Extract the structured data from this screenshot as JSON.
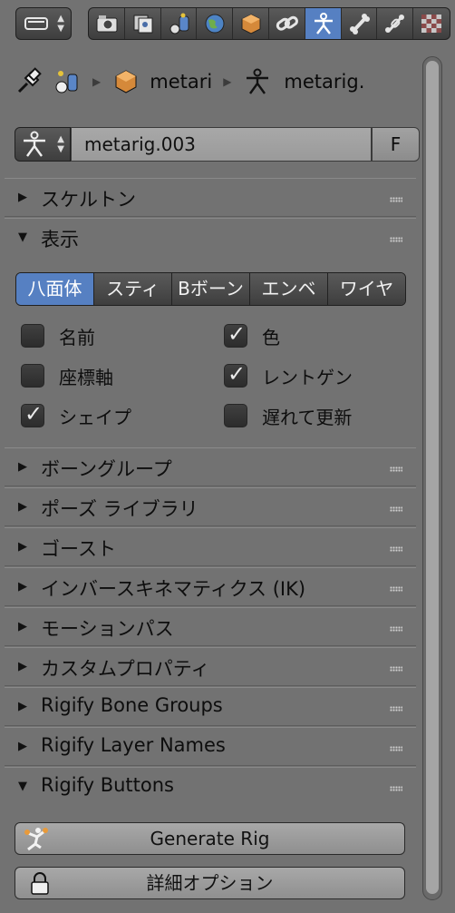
{
  "header": {
    "editor_type_icon": "properties-editor-icon",
    "tabs": [
      {
        "name": "render",
        "icon": "camera-icon",
        "active": false
      },
      {
        "name": "layers",
        "icon": "layers-icon",
        "active": false
      },
      {
        "name": "scene",
        "icon": "scene-icon",
        "active": false
      },
      {
        "name": "world",
        "icon": "world-icon",
        "active": false
      },
      {
        "name": "object",
        "icon": "cube-icon",
        "active": false
      },
      {
        "name": "constraints",
        "icon": "link-icon",
        "active": false
      },
      {
        "name": "armature",
        "icon": "armature-icon",
        "active": true
      },
      {
        "name": "bone",
        "icon": "bone-icon",
        "active": false
      },
      {
        "name": "bone-constraints",
        "icon": "bone-constraint-icon",
        "active": false
      },
      {
        "name": "texture",
        "icon": "checker-icon",
        "active": false
      }
    ]
  },
  "breadcrumbs": {
    "object_name": "metari",
    "armature_name": "metarig."
  },
  "armature": {
    "datablock_name": "metarig.003",
    "fake_user_label": "F"
  },
  "panels": {
    "skeleton": "スケルトン",
    "display": "表示",
    "bone_groups": "ボーングループ",
    "pose_library": "ポーズ ライブラリ",
    "ghost": "ゴースト",
    "ik": "インバースキネマティクス (IK)",
    "motion_paths": "モーションパス",
    "custom_props": "カスタムプロパティ",
    "rigify_bone_groups": "Rigify Bone Groups",
    "rigify_layer_names": "Rigify Layer Names",
    "rigify_buttons": "Rigify Buttons"
  },
  "display": {
    "tabs": [
      "八面体",
      "スティ",
      "Bボーン",
      "エンベ",
      "ワイヤ"
    ],
    "active_tab": 0,
    "options": {
      "names": {
        "label": "名前",
        "checked": false
      },
      "axes": {
        "label": "座標軸",
        "checked": false
      },
      "shapes": {
        "label": "シェイプ",
        "checked": true
      },
      "colors": {
        "label": "色",
        "checked": true
      },
      "xray": {
        "label": "レントゲン",
        "checked": true
      },
      "delay": {
        "label": "遅れて更新",
        "checked": false
      }
    }
  },
  "rigify": {
    "generate_label": "Generate Rig",
    "advanced_label": "詳細オプション"
  },
  "colors": {
    "background": "#727272",
    "active_blue": "#5680c2"
  }
}
